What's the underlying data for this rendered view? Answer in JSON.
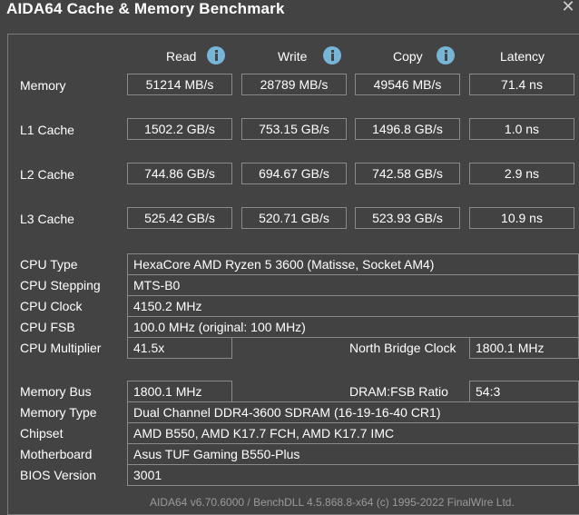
{
  "window": {
    "title": "AIDA64 Cache & Memory Benchmark"
  },
  "columns": {
    "read": "Read",
    "write": "Write",
    "copy": "Copy",
    "latency": "Latency"
  },
  "benchmarks": [
    {
      "label": "Memory",
      "read": "51214 MB/s",
      "write": "28789 MB/s",
      "copy": "49546 MB/s",
      "latency": "71.4 ns"
    },
    {
      "label": "L1 Cache",
      "read": "1502.2 GB/s",
      "write": "753.15 GB/s",
      "copy": "1496.8 GB/s",
      "latency": "1.0 ns"
    },
    {
      "label": "L2 Cache",
      "read": "744.86 GB/s",
      "write": "694.67 GB/s",
      "copy": "742.58 GB/s",
      "latency": "2.9 ns"
    },
    {
      "label": "L3 Cache",
      "read": "525.42 GB/s",
      "write": "520.71 GB/s",
      "copy": "523.93 GB/s",
      "latency": "10.9 ns"
    }
  ],
  "info": {
    "cpu_type": {
      "label": "CPU Type",
      "value": "HexaCore AMD Ryzen 5 3600  (Matisse, Socket AM4)"
    },
    "cpu_stepping": {
      "label": "CPU Stepping",
      "value": "MTS-B0"
    },
    "cpu_clock": {
      "label": "CPU Clock",
      "value": "4150.2 MHz"
    },
    "cpu_fsb": {
      "label": "CPU FSB",
      "value": "100.0 MHz  (original: 100 MHz)"
    },
    "cpu_multiplier": {
      "label": "CPU Multiplier",
      "value": "41.5x"
    },
    "north_bridge": {
      "label": "North Bridge Clock",
      "value": "1800.1 MHz"
    },
    "memory_bus": {
      "label": "Memory Bus",
      "value": "1800.1 MHz"
    },
    "dram_ratio": {
      "label": "DRAM:FSB Ratio",
      "value": "54:3"
    },
    "memory_type": {
      "label": "Memory Type",
      "value": "Dual Channel DDR4-3600 SDRAM  (16-19-16-40 CR1)"
    },
    "chipset": {
      "label": "Chipset",
      "value": "AMD B550, AMD K17.7 FCH, AMD K17.7 IMC"
    },
    "motherboard": {
      "label": "Motherboard",
      "value": "Asus TUF Gaming B550-Plus"
    },
    "bios_version": {
      "label": "BIOS Version",
      "value": "3001"
    }
  },
  "footer": {
    "text": "AIDA64 v6.70.6000 / BenchDLL 4.5.868.8-x64  (c) 1995-2022 FinalWire Ltd."
  },
  "icons": {
    "info": "info-icon",
    "close": "close-icon"
  },
  "colors": {
    "background": "#434343",
    "info_icon": "#78b4d6",
    "box_border": "#8a8a8a"
  }
}
